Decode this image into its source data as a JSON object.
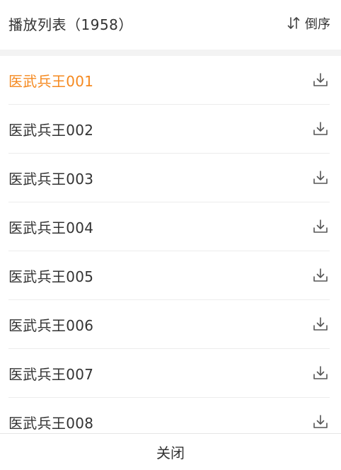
{
  "header": {
    "title": "播放列表（1958）",
    "sort_label": "倒序",
    "sort_icon": "sort-arrows-icon"
  },
  "colors": {
    "active": "#f5891f",
    "text": "#333333",
    "divider": "#ececec",
    "icon": "#555555"
  },
  "playlist": {
    "items": [
      {
        "label": "医武兵王001",
        "active": true,
        "icon": "download-icon"
      },
      {
        "label": "医武兵王002",
        "active": false,
        "icon": "download-icon"
      },
      {
        "label": "医武兵王003",
        "active": false,
        "icon": "download-icon"
      },
      {
        "label": "医武兵王004",
        "active": false,
        "icon": "download-icon"
      },
      {
        "label": "医武兵王005",
        "active": false,
        "icon": "download-icon"
      },
      {
        "label": "医武兵王006",
        "active": false,
        "icon": "download-icon"
      },
      {
        "label": "医武兵王007",
        "active": false,
        "icon": "download-icon"
      },
      {
        "label": "医武兵王008",
        "active": false,
        "icon": "download-icon"
      }
    ]
  },
  "footer": {
    "close_label": "关闭"
  }
}
